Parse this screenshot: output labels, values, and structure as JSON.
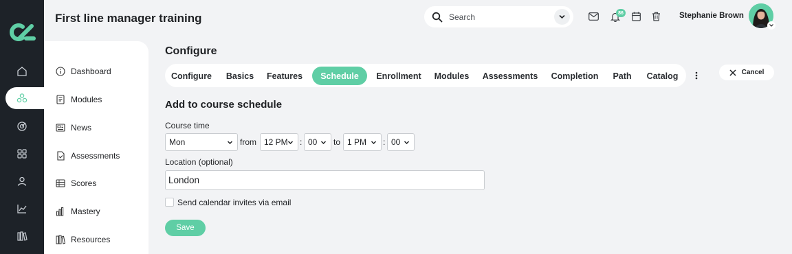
{
  "app": {
    "title": "First line manager training"
  },
  "search": {
    "placeholder": "Search"
  },
  "header": {
    "notification_count": "86",
    "user_name": "Stephanie Brown",
    "icons": [
      "mail-icon",
      "bell-icon",
      "calendar-icon",
      "trash-icon"
    ]
  },
  "rail": {
    "icons": [
      "home-icon",
      "network-icon",
      "target-icon",
      "grid-icon",
      "user-icon",
      "chart-icon",
      "library-icon"
    ],
    "active": "network-icon"
  },
  "sidebar": {
    "items": [
      {
        "label": "Dashboard",
        "icon": "info-icon"
      },
      {
        "label": "Modules",
        "icon": "book-icon"
      },
      {
        "label": "News",
        "icon": "newspaper-icon"
      },
      {
        "label": "Assessments",
        "icon": "document-check-icon"
      },
      {
        "label": "Scores",
        "icon": "table-icon"
      },
      {
        "label": "Mastery",
        "icon": "bars-icon"
      },
      {
        "label": "Resources",
        "icon": "books-icon"
      }
    ]
  },
  "main": {
    "section_title": "Configure",
    "tabs": [
      {
        "label": "Configure"
      },
      {
        "label": "Basics"
      },
      {
        "label": "Features"
      },
      {
        "label": "Schedule"
      },
      {
        "label": "Enrollment"
      },
      {
        "label": "Modules"
      },
      {
        "label": "Assessments"
      },
      {
        "label": "Completion"
      },
      {
        "label": "Path"
      },
      {
        "label": "Catalog"
      }
    ],
    "active_tab": "Schedule",
    "cancel_label": "Cancel"
  },
  "form": {
    "title": "Add to course schedule",
    "course_time_label": "Course time",
    "day_value": "Mon",
    "from_word": "from",
    "from_hour": "12 PM",
    "colon": ":",
    "from_minute": "00",
    "to_word": "to",
    "to_hour": "1 PM",
    "to_minute": "00",
    "location_label": "Location (optional)",
    "location_value": "London",
    "invite_label": "Send calendar invites via email",
    "invite_checked": false,
    "save_label": "Save"
  },
  "colors": {
    "accent": "#5fcea5",
    "rail_bg": "#1d2228",
    "page_bg": "#f2f3f5"
  }
}
